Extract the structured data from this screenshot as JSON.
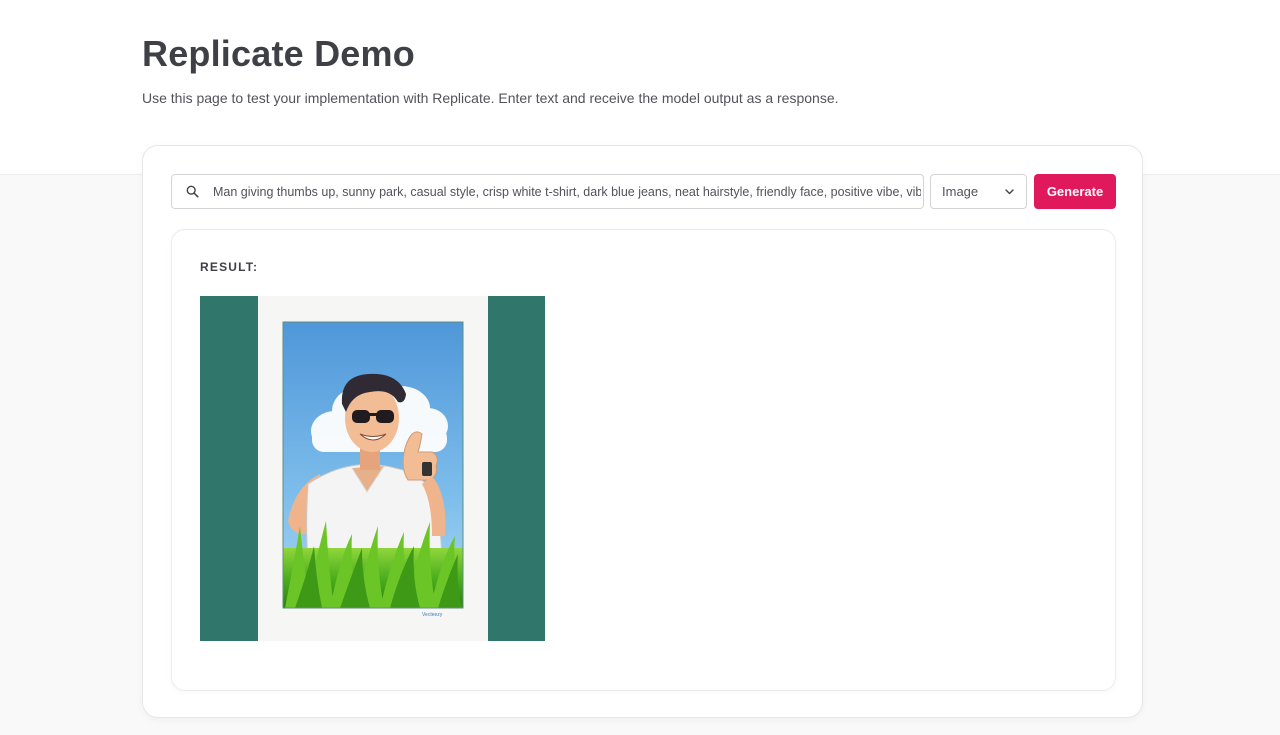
{
  "header": {
    "title": "Replicate Demo",
    "subtitle": "Use this page to test your implementation with Replicate. Enter text and receive the model output as a response."
  },
  "form": {
    "prompt_value": "Man giving thumbs up, sunny park, casual style, crisp white t-shirt, dark blue jeans, neat hairstyle, friendly face, positive vibe, vibrant",
    "search_icon": "search-icon",
    "output_type": {
      "selected": "Image",
      "icon": "chevron-down-icon"
    },
    "generate_label": "Generate"
  },
  "result": {
    "label": "RESULT:",
    "image": {
      "subject": "cartoon man in white t-shirt and sunglasses giving thumbs up in grass under blue sky",
      "watermark": "Vecteezy"
    }
  },
  "colors": {
    "accent": "#e0185c",
    "image_side_panels": "#31766b",
    "sky": "#5ba7df",
    "grass": "#4caf1e"
  }
}
